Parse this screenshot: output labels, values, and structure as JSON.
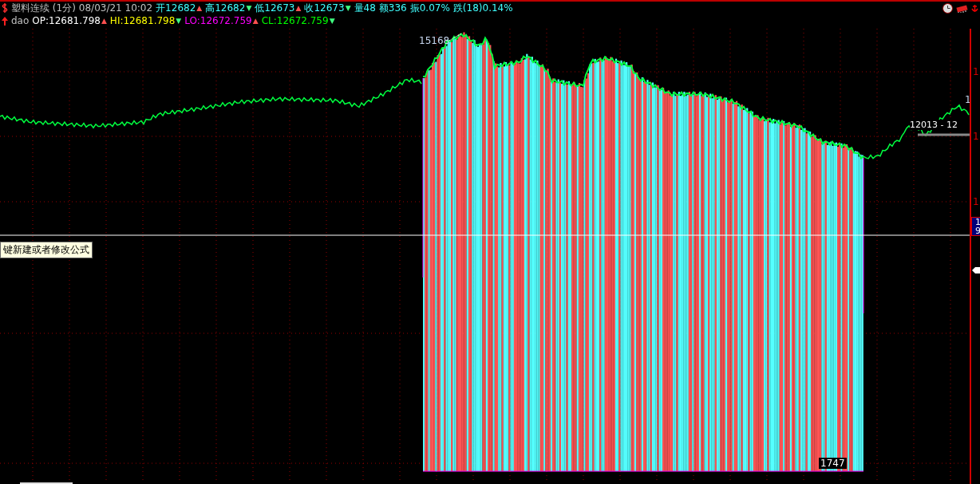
{
  "header": {
    "title": "塑料连续 (1分)",
    "datetime": "08/03/21 10:02",
    "quotes": [
      {
        "label": "开12682",
        "mark": "▲",
        "color": "#ff5050"
      },
      {
        "label": "高12682",
        "mark": "▼",
        "color": "#40ff80"
      },
      {
        "label": "低12673",
        "mark": "▲",
        "color": "#ff5050"
      },
      {
        "label": "收12673",
        "mark": "▼",
        "color": "#40ff80"
      },
      {
        "label": "量48"
      },
      {
        "label": "额336"
      },
      {
        "label": "振0.07%"
      },
      {
        "label": "跌(18)0.14%"
      }
    ]
  },
  "indicator": {
    "name": "dao",
    "values": [
      {
        "label": "OP:12681.798",
        "color": "#ffffff",
        "mark": "▲"
      },
      {
        "label": "HI:12681.798",
        "color": "#ffff00",
        "mark": "▼"
      },
      {
        "label": "LO:12672.759",
        "color": "#ff00ff",
        "mark": "▲"
      },
      {
        "label": "CL:12672.759",
        "color": "#00ff00",
        "mark": "▼"
      }
    ]
  },
  "chart": {
    "peak_label": "15168",
    "volume_label": "1747",
    "range_label": "12013 - 12",
    "last_label": "1",
    "formula_tip": "键新建或者修改公式"
  },
  "axis": {
    "ticks": [
      "1",
      "1",
      "1"
    ],
    "badge": [
      "1",
      "9"
    ]
  }
}
